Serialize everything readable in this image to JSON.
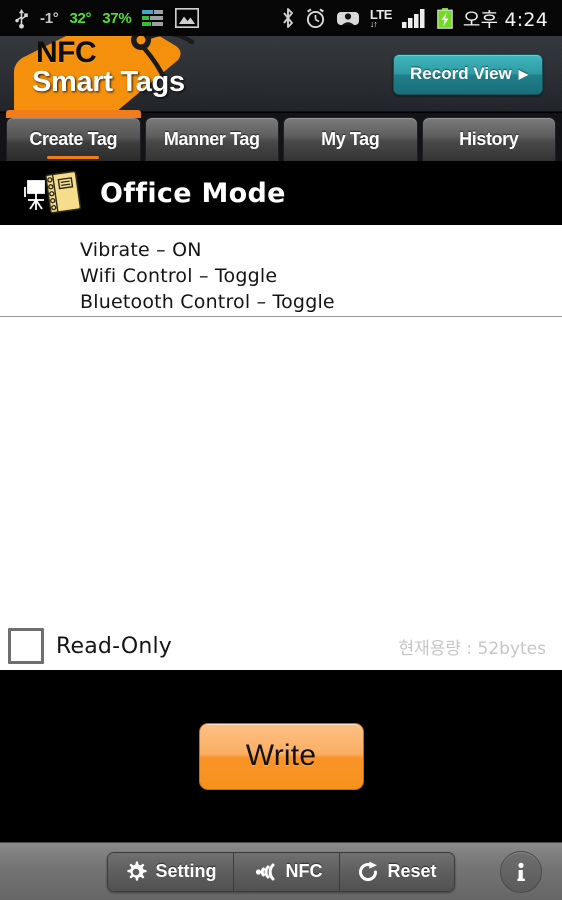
{
  "statusbar": {
    "usb_icon": "usb-icon",
    "temp_outdoor": "-1°",
    "temp_indoor": "32°",
    "humidity": "37%",
    "equalizer_icon": "equalizer-icon",
    "gallery_icon": "gallery-icon",
    "bluetooth_icon": "bluetooth-icon",
    "alarm_icon": "alarm-clock-icon",
    "mute_icon": "vibrate-mute-icon",
    "network_label": "LTE",
    "network_arrows": "↓↑",
    "signal_icon": "signal-bars-icon",
    "battery_icon": "battery-charging-icon",
    "clock": "오후 4:24"
  },
  "header": {
    "logo_top": "NFC",
    "logo_bottom": "Smart Tags",
    "record_view_label": "Record View",
    "record_view_caret": "▶"
  },
  "tabs": [
    {
      "label": "Create Tag",
      "active": true
    },
    {
      "label": "Manner Tag",
      "active": false
    },
    {
      "label": "My Tag",
      "active": false
    },
    {
      "label": "History",
      "active": false
    }
  ],
  "mode": {
    "icon": "office-notebook-desk-icon",
    "title": "Office Mode"
  },
  "records": [
    "Vibrate – ON",
    "Wifi Control – Toggle",
    "Bluetooth Control – Toggle"
  ],
  "footer": {
    "readonly_label": "Read-Only",
    "readonly_checked": false,
    "capacity": "현재용량 : 52bytes"
  },
  "write": {
    "label": "Write"
  },
  "bottombar": {
    "buttons": [
      {
        "label": "Setting",
        "icon": "gear-icon"
      },
      {
        "label": "NFC",
        "icon": "nfc-wave-icon"
      },
      {
        "label": "Reset",
        "icon": "refresh-icon"
      }
    ],
    "info_icon": "info-icon"
  },
  "colors": {
    "accent_orange": "#f07c1b",
    "record_button_teal": "#2f9aa3",
    "write_button_orange": "#fb9328",
    "header_dark": "#2a2d32",
    "status_green": "#56dd3a"
  }
}
